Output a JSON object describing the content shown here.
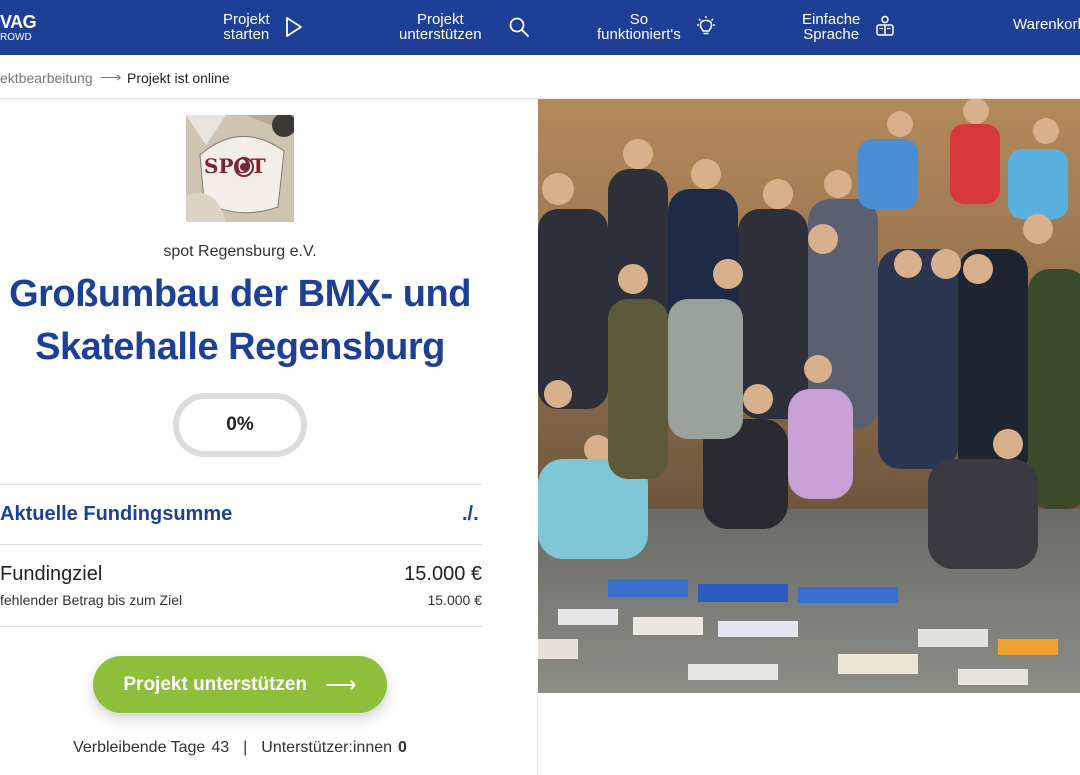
{
  "nav": {
    "logo_line1": "VAG",
    "logo_line2": "ROWD",
    "items": [
      {
        "line1": "Projekt",
        "line2": "starten",
        "icon": "play-icon"
      },
      {
        "line1": "Projekt",
        "line2": "unterstützen",
        "icon": "search-icon"
      },
      {
        "line1": "So",
        "line2": "funktioniert's",
        "icon": "lightbulb-icon"
      },
      {
        "line1": "Einfache",
        "line2": "Sprache",
        "icon": "easy-language-icon"
      }
    ],
    "cart_label": "Warenkorb"
  },
  "breadcrumb": {
    "previous": "ektbearbeitung",
    "separator": "⟶",
    "current": "Projekt ist online"
  },
  "project": {
    "logo_text": "SPOT",
    "org_name": "spot Regensburg e.V.",
    "title": "Großumbau der BMX- und Skatehalle Regensburg",
    "progress_percent": "0%",
    "funding_label": "Aktuelle Fundingsumme",
    "funding_value": "./.",
    "goal_label": "Fundingziel",
    "goal_value": "15.000 €",
    "missing_label": "fehlender Betrag bis zum Ziel",
    "missing_value": "15.000 €",
    "cta_label": "Projekt unterstützen",
    "cta_arrow": "⟶",
    "days_label": "Verbleibende Tage",
    "days_value": "43",
    "stats_separator": "|",
    "supporters_label": "Unterstützer:innen",
    "supporters_value": "0"
  },
  "colors": {
    "brand_blue": "#1d3f95",
    "cta_green": "#8dbf3a",
    "progress_ring": "#dcdcdc"
  }
}
